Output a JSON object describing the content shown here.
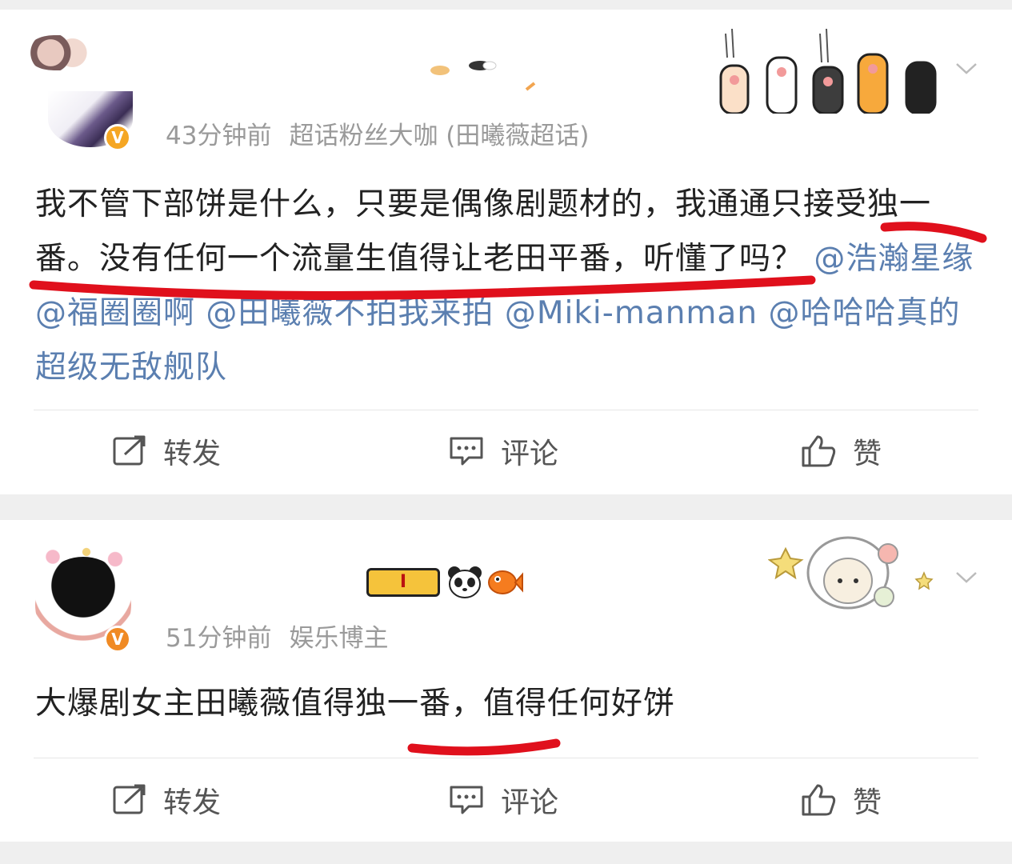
{
  "posts": [
    {
      "time": "43分钟前",
      "source": "超话粉丝大咖 (田曦薇超话)",
      "verified_badge": "V",
      "text_before_mentions": "我不管下部饼是什么，只要是偶像剧题材的，我通通只接受独一番。没有任何一个流量生值得让老田平番，听懂了吗？",
      "mentions": [
        "@浩瀚星缘",
        "@福圈圈啊",
        "@田曦薇不拍我来拍",
        "@Miki-manman",
        "@哈哈哈真的超级无敌舰队"
      ],
      "actions": {
        "repost": "转发",
        "comment": "评论",
        "like": "赞"
      },
      "badge_color": "#f5a623"
    },
    {
      "time": "51分钟前",
      "source": "娱乐博主",
      "verified_badge": "V",
      "level_badge": "I",
      "text": "大爆剧女主田曦薇值得独一番，值得任何好饼",
      "actions": {
        "repost": "转发",
        "comment": "评论",
        "like": "赞"
      },
      "badge_color": "#f08a24"
    }
  ],
  "colors": {
    "mention": "#5b7fb0",
    "underline": "#e0101c",
    "meta": "#9a9a9a"
  },
  "icons": [
    "chevron-down-icon",
    "repost-icon",
    "comment-icon",
    "like-icon",
    "cat-paws-decoration",
    "sheep-decoration",
    "panda-icon",
    "fish-icon"
  ]
}
